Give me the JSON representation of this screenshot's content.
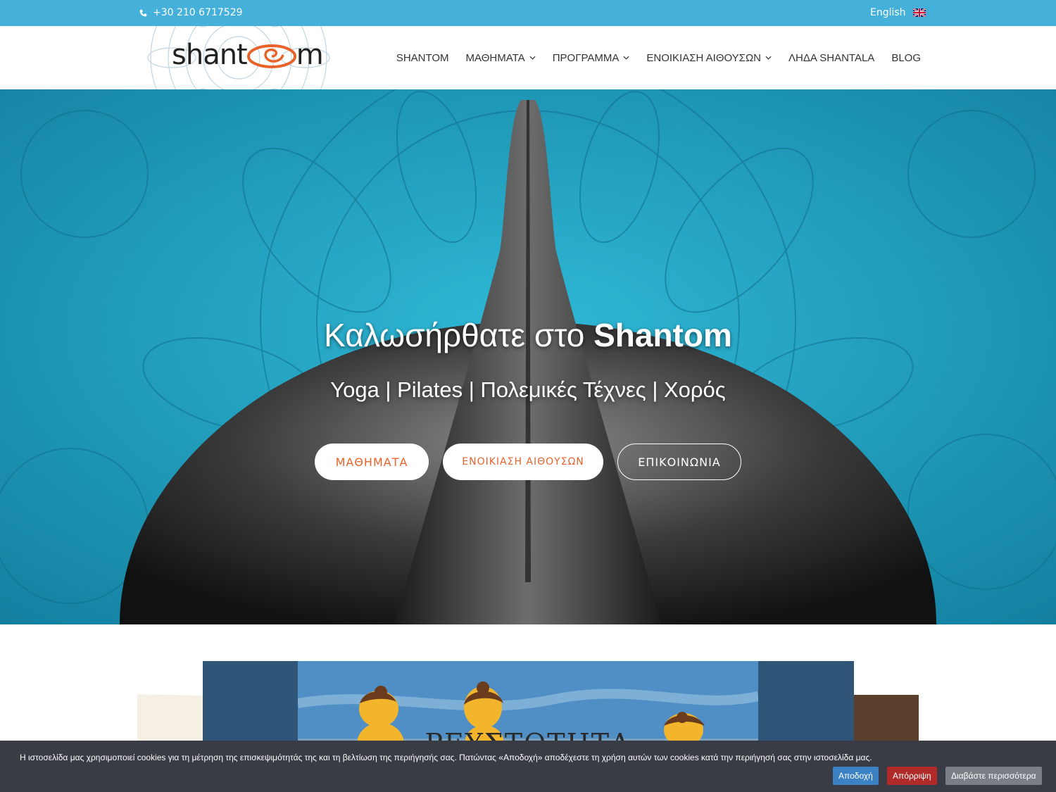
{
  "topbar": {
    "phone": "+30 210 6717529",
    "language": "English",
    "phone_icon": "phone-icon",
    "flag_icon": "uk-flag-icon"
  },
  "header": {
    "logo_prefix": "shant",
    "logo_suffix": "m",
    "nav": [
      {
        "label": "SHANTOM",
        "has_dropdown": false
      },
      {
        "label": "ΜΑΘΗΜΑΤΑ",
        "has_dropdown": true
      },
      {
        "label": "ΠΡΟΓΡΑΜΜΑ",
        "has_dropdown": true
      },
      {
        "label": "ΕΝΟΙΚΙΑΣΗ ΑΙΘΟΥΣΩΝ",
        "has_dropdown": true
      },
      {
        "label": "ΛΗΔΑ SHANTALA",
        "has_dropdown": false
      },
      {
        "label": "BLOG",
        "has_dropdown": false
      }
    ]
  },
  "hero": {
    "title_prefix": "Καλωσήρθατε στο ",
    "title_brand": "Shantom",
    "subtitle": "Yoga | Pilates | Πολεμικές Τέχνες | Χορός",
    "buttons": [
      {
        "label": "ΜΑΘΗΜΑΤΑ"
      },
      {
        "label": "ΕΝΟΙΚΙΑΣΗ ΑΙΘΟΥΣΩΝ"
      },
      {
        "label": "ΕΠΙΚΟΙΝΩΝΙΑ"
      }
    ]
  },
  "slider": {
    "caption": "ΡΕΥΣΤΟΤΗΤΑ"
  },
  "cookie": {
    "text": "Η ιστοσελίδα μας χρησιμοποιεί cookies για τη μέτρηση της επισκεψιμότητάς της και τη βελτίωση της περιήγησής σας. Πατώντας «Αποδοχή» αποδέχεστε τη χρήση αυτών των cookies κατά την περιήγησή σας στην ιστοσελίδα μας.",
    "accept": "Αποδοχή",
    "reject": "Απόρριψη",
    "read_more": "Διαβάστε περισσότερα"
  },
  "colors": {
    "topbar": "#45b0d9",
    "accent": "#e8632a",
    "hero_bg": "#1aa7c7",
    "cookie_bg": "#3a3c45"
  }
}
